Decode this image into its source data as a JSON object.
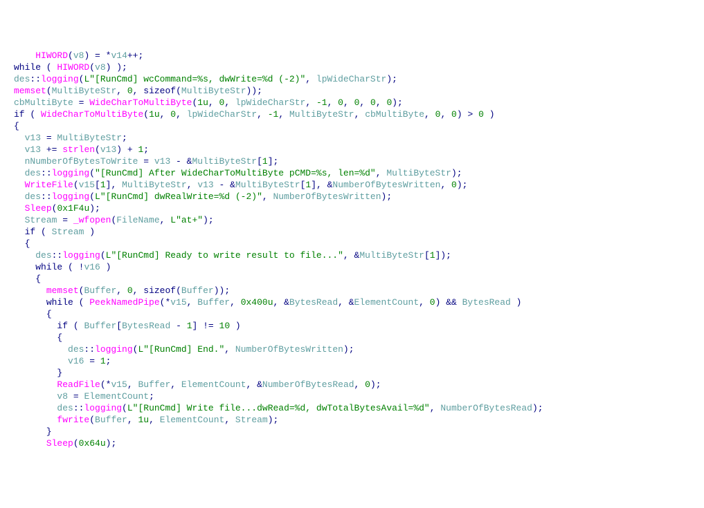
{
  "lines": [
    {
      "indent": 2,
      "tokens": [
        {
          "t": "  ",
          "c": "kw"
        },
        {
          "t": "HIWORD",
          "c": "fn"
        },
        {
          "t": "(",
          "c": "punc"
        },
        {
          "t": "v8",
          "c": "var"
        },
        {
          "t": ") = *",
          "c": "punc"
        },
        {
          "t": "v14",
          "c": "var"
        },
        {
          "t": "++;",
          "c": "punc"
        }
      ]
    },
    {
      "indent": 0,
      "tokens": [
        {
          "t": "while ( ",
          "c": "kw"
        },
        {
          "t": "HIWORD",
          "c": "fn"
        },
        {
          "t": "(",
          "c": "punc"
        },
        {
          "t": "v8",
          "c": "var"
        },
        {
          "t": ") );",
          "c": "punc"
        }
      ]
    },
    {
      "indent": 0,
      "tokens": [
        {
          "t": "des",
          "c": "var"
        },
        {
          "t": "::",
          "c": "punc"
        },
        {
          "t": "logging",
          "c": "fn"
        },
        {
          "t": "(",
          "c": "punc"
        },
        {
          "t": "L\"[RunCmd] wcCommand=%s, dwWrite=%d (-2)\"",
          "c": "str"
        },
        {
          "t": ", ",
          "c": "punc"
        },
        {
          "t": "lpWideCharStr",
          "c": "var"
        },
        {
          "t": ");",
          "c": "punc"
        }
      ]
    },
    {
      "indent": 0,
      "tokens": [
        {
          "t": "memset",
          "c": "fn"
        },
        {
          "t": "(",
          "c": "punc"
        },
        {
          "t": "MultiByteStr",
          "c": "var"
        },
        {
          "t": ", ",
          "c": "punc"
        },
        {
          "t": "0",
          "c": "num"
        },
        {
          "t": ", ",
          "c": "punc"
        },
        {
          "t": "sizeof",
          "c": "kw"
        },
        {
          "t": "(",
          "c": "punc"
        },
        {
          "t": "MultiByteStr",
          "c": "var"
        },
        {
          "t": "));",
          "c": "punc"
        }
      ]
    },
    {
      "indent": 0,
      "tokens": [
        {
          "t": "cbMultiByte",
          "c": "var"
        },
        {
          "t": " = ",
          "c": "punc"
        },
        {
          "t": "WideCharToMultiByte",
          "c": "fn"
        },
        {
          "t": "(",
          "c": "punc"
        },
        {
          "t": "1u",
          "c": "num"
        },
        {
          "t": ", ",
          "c": "punc"
        },
        {
          "t": "0",
          "c": "num"
        },
        {
          "t": ", ",
          "c": "punc"
        },
        {
          "t": "lpWideCharStr",
          "c": "var"
        },
        {
          "t": ", ",
          "c": "punc"
        },
        {
          "t": "-1",
          "c": "num"
        },
        {
          "t": ", ",
          "c": "punc"
        },
        {
          "t": "0",
          "c": "num"
        },
        {
          "t": ", ",
          "c": "punc"
        },
        {
          "t": "0",
          "c": "num"
        },
        {
          "t": ", ",
          "c": "punc"
        },
        {
          "t": "0",
          "c": "num"
        },
        {
          "t": ", ",
          "c": "punc"
        },
        {
          "t": "0",
          "c": "num"
        },
        {
          "t": ");",
          "c": "punc"
        }
      ]
    },
    {
      "indent": 0,
      "tokens": [
        {
          "t": "if ( ",
          "c": "kw"
        },
        {
          "t": "WideCharToMultiByte",
          "c": "fn"
        },
        {
          "t": "(",
          "c": "punc"
        },
        {
          "t": "1u",
          "c": "num"
        },
        {
          "t": ", ",
          "c": "punc"
        },
        {
          "t": "0",
          "c": "num"
        },
        {
          "t": ", ",
          "c": "punc"
        },
        {
          "t": "lpWideCharStr",
          "c": "var"
        },
        {
          "t": ", ",
          "c": "punc"
        },
        {
          "t": "-1",
          "c": "num"
        },
        {
          "t": ", ",
          "c": "punc"
        },
        {
          "t": "MultiByteStr",
          "c": "var"
        },
        {
          "t": ", ",
          "c": "punc"
        },
        {
          "t": "cbMultiByte",
          "c": "var"
        },
        {
          "t": ", ",
          "c": "punc"
        },
        {
          "t": "0",
          "c": "num"
        },
        {
          "t": ", ",
          "c": "punc"
        },
        {
          "t": "0",
          "c": "num"
        },
        {
          "t": ") > ",
          "c": "punc"
        },
        {
          "t": "0",
          "c": "num"
        },
        {
          "t": " )",
          "c": "punc"
        }
      ]
    },
    {
      "indent": 0,
      "tokens": [
        {
          "t": "{",
          "c": "punc"
        }
      ]
    },
    {
      "indent": 2,
      "tokens": [
        {
          "t": "v13",
          "c": "var"
        },
        {
          "t": " = ",
          "c": "punc"
        },
        {
          "t": "MultiByteStr",
          "c": "var"
        },
        {
          "t": ";",
          "c": "punc"
        }
      ]
    },
    {
      "indent": 2,
      "tokens": [
        {
          "t": "v13",
          "c": "var"
        },
        {
          "t": " += ",
          "c": "punc"
        },
        {
          "t": "strlen",
          "c": "fn"
        },
        {
          "t": "(",
          "c": "punc"
        },
        {
          "t": "v13",
          "c": "var"
        },
        {
          "t": ") + ",
          "c": "punc"
        },
        {
          "t": "1",
          "c": "num"
        },
        {
          "t": ";",
          "c": "punc"
        }
      ]
    },
    {
      "indent": 2,
      "tokens": [
        {
          "t": "nNumberOfBytesToWrite",
          "c": "var"
        },
        {
          "t": " = ",
          "c": "punc"
        },
        {
          "t": "v13",
          "c": "var"
        },
        {
          "t": " - &",
          "c": "punc"
        },
        {
          "t": "MultiByteStr",
          "c": "var"
        },
        {
          "t": "[",
          "c": "punc"
        },
        {
          "t": "1",
          "c": "num"
        },
        {
          "t": "];",
          "c": "punc"
        }
      ]
    },
    {
      "indent": 2,
      "tokens": [
        {
          "t": "des",
          "c": "var"
        },
        {
          "t": "::",
          "c": "punc"
        },
        {
          "t": "logging",
          "c": "fn"
        },
        {
          "t": "(",
          "c": "punc"
        },
        {
          "t": "\"[RunCmd] After WideCharToMultiByte pCMD=%s, len=%d\"",
          "c": "str"
        },
        {
          "t": ", ",
          "c": "punc"
        },
        {
          "t": "MultiByteStr",
          "c": "var"
        },
        {
          "t": ");",
          "c": "punc"
        }
      ]
    },
    {
      "indent": 2,
      "tokens": [
        {
          "t": "WriteFile",
          "c": "fn"
        },
        {
          "t": "(",
          "c": "punc"
        },
        {
          "t": "v15",
          "c": "var"
        },
        {
          "t": "[",
          "c": "punc"
        },
        {
          "t": "1",
          "c": "num"
        },
        {
          "t": "], ",
          "c": "punc"
        },
        {
          "t": "MultiByteStr",
          "c": "var"
        },
        {
          "t": ", ",
          "c": "punc"
        },
        {
          "t": "v13",
          "c": "var"
        },
        {
          "t": " - &",
          "c": "punc"
        },
        {
          "t": "MultiByteStr",
          "c": "var"
        },
        {
          "t": "[",
          "c": "punc"
        },
        {
          "t": "1",
          "c": "num"
        },
        {
          "t": "], &",
          "c": "punc"
        },
        {
          "t": "NumberOfBytesWritten",
          "c": "var"
        },
        {
          "t": ", ",
          "c": "punc"
        },
        {
          "t": "0",
          "c": "num"
        },
        {
          "t": ");",
          "c": "punc"
        }
      ]
    },
    {
      "indent": 2,
      "tokens": [
        {
          "t": "des",
          "c": "var"
        },
        {
          "t": "::",
          "c": "punc"
        },
        {
          "t": "logging",
          "c": "fn"
        },
        {
          "t": "(",
          "c": "punc"
        },
        {
          "t": "L\"[RunCmd] dwRealWrite=%d (-2)\"",
          "c": "str"
        },
        {
          "t": ", ",
          "c": "punc"
        },
        {
          "t": "NumberOfBytesWritten",
          "c": "var"
        },
        {
          "t": ");",
          "c": "punc"
        }
      ]
    },
    {
      "indent": 2,
      "tokens": [
        {
          "t": "Sleep",
          "c": "fn"
        },
        {
          "t": "(",
          "c": "punc"
        },
        {
          "t": "0x1F4u",
          "c": "num"
        },
        {
          "t": ");",
          "c": "punc"
        }
      ]
    },
    {
      "indent": 2,
      "tokens": [
        {
          "t": "Stream",
          "c": "var"
        },
        {
          "t": " = ",
          "c": "punc"
        },
        {
          "t": "_wfopen",
          "c": "fn"
        },
        {
          "t": "(",
          "c": "punc"
        },
        {
          "t": "FileName",
          "c": "var"
        },
        {
          "t": ", ",
          "c": "punc"
        },
        {
          "t": "L\"at+\"",
          "c": "str"
        },
        {
          "t": ");",
          "c": "punc"
        }
      ]
    },
    {
      "indent": 2,
      "tokens": [
        {
          "t": "if ( ",
          "c": "kw"
        },
        {
          "t": "Stream",
          "c": "var"
        },
        {
          "t": " )",
          "c": "punc"
        }
      ]
    },
    {
      "indent": 2,
      "tokens": [
        {
          "t": "{",
          "c": "punc"
        }
      ]
    },
    {
      "indent": 4,
      "tokens": [
        {
          "t": "des",
          "c": "var"
        },
        {
          "t": "::",
          "c": "punc"
        },
        {
          "t": "logging",
          "c": "fn"
        },
        {
          "t": "(",
          "c": "punc"
        },
        {
          "t": "L\"[RunCmd] Ready to write result to file...\"",
          "c": "str"
        },
        {
          "t": ", &",
          "c": "punc"
        },
        {
          "t": "MultiByteStr",
          "c": "var"
        },
        {
          "t": "[",
          "c": "punc"
        },
        {
          "t": "1",
          "c": "num"
        },
        {
          "t": "]);",
          "c": "punc"
        }
      ]
    },
    {
      "indent": 4,
      "tokens": [
        {
          "t": "while ( !",
          "c": "kw"
        },
        {
          "t": "v16",
          "c": "var"
        },
        {
          "t": " )",
          "c": "punc"
        }
      ]
    },
    {
      "indent": 4,
      "tokens": [
        {
          "t": "{",
          "c": "punc"
        }
      ]
    },
    {
      "indent": 6,
      "tokens": [
        {
          "t": "memset",
          "c": "fn"
        },
        {
          "t": "(",
          "c": "punc"
        },
        {
          "t": "Buffer",
          "c": "var"
        },
        {
          "t": ", ",
          "c": "punc"
        },
        {
          "t": "0",
          "c": "num"
        },
        {
          "t": ", ",
          "c": "punc"
        },
        {
          "t": "sizeof",
          "c": "kw"
        },
        {
          "t": "(",
          "c": "punc"
        },
        {
          "t": "Buffer",
          "c": "var"
        },
        {
          "t": "));",
          "c": "punc"
        }
      ]
    },
    {
      "indent": 6,
      "tokens": [
        {
          "t": "while ( ",
          "c": "kw"
        },
        {
          "t": "PeekNamedPipe",
          "c": "fn"
        },
        {
          "t": "(*",
          "c": "punc"
        },
        {
          "t": "v15",
          "c": "var"
        },
        {
          "t": ", ",
          "c": "punc"
        },
        {
          "t": "Buffer",
          "c": "var"
        },
        {
          "t": ", ",
          "c": "punc"
        },
        {
          "t": "0x400u",
          "c": "num"
        },
        {
          "t": ", &",
          "c": "punc"
        },
        {
          "t": "BytesRead",
          "c": "var"
        },
        {
          "t": ", &",
          "c": "punc"
        },
        {
          "t": "ElementCount",
          "c": "var"
        },
        {
          "t": ", ",
          "c": "punc"
        },
        {
          "t": "0",
          "c": "num"
        },
        {
          "t": ") && ",
          "c": "punc"
        },
        {
          "t": "BytesRead",
          "c": "var"
        },
        {
          "t": " )",
          "c": "punc"
        }
      ]
    },
    {
      "indent": 6,
      "tokens": [
        {
          "t": "{",
          "c": "punc"
        }
      ]
    },
    {
      "indent": 8,
      "tokens": [
        {
          "t": "if ( ",
          "c": "kw"
        },
        {
          "t": "Buffer",
          "c": "var"
        },
        {
          "t": "[",
          "c": "punc"
        },
        {
          "t": "BytesRead",
          "c": "var"
        },
        {
          "t": " - ",
          "c": "punc"
        },
        {
          "t": "1",
          "c": "num"
        },
        {
          "t": "] != ",
          "c": "punc"
        },
        {
          "t": "10",
          "c": "num"
        },
        {
          "t": " )",
          "c": "punc"
        }
      ]
    },
    {
      "indent": 8,
      "tokens": [
        {
          "t": "{",
          "c": "punc"
        }
      ]
    },
    {
      "indent": 10,
      "tokens": [
        {
          "t": "des",
          "c": "var"
        },
        {
          "t": "::",
          "c": "punc"
        },
        {
          "t": "logging",
          "c": "fn"
        },
        {
          "t": "(",
          "c": "punc"
        },
        {
          "t": "L\"[RunCmd] End.\"",
          "c": "str"
        },
        {
          "t": ", ",
          "c": "punc"
        },
        {
          "t": "NumberOfBytesWritten",
          "c": "var"
        },
        {
          "t": ");",
          "c": "punc"
        }
      ]
    },
    {
      "indent": 10,
      "tokens": [
        {
          "t": "v16",
          "c": "var"
        },
        {
          "t": " = ",
          "c": "punc"
        },
        {
          "t": "1",
          "c": "num"
        },
        {
          "t": ";",
          "c": "punc"
        }
      ]
    },
    {
      "indent": 8,
      "tokens": [
        {
          "t": "}",
          "c": "punc"
        }
      ]
    },
    {
      "indent": 8,
      "tokens": [
        {
          "t": "ReadFile",
          "c": "fn"
        },
        {
          "t": "(*",
          "c": "punc"
        },
        {
          "t": "v15",
          "c": "var"
        },
        {
          "t": ", ",
          "c": "punc"
        },
        {
          "t": "Buffer",
          "c": "var"
        },
        {
          "t": ", ",
          "c": "punc"
        },
        {
          "t": "ElementCount",
          "c": "var"
        },
        {
          "t": ", &",
          "c": "punc"
        },
        {
          "t": "NumberOfBytesRead",
          "c": "var"
        },
        {
          "t": ", ",
          "c": "punc"
        },
        {
          "t": "0",
          "c": "num"
        },
        {
          "t": ");",
          "c": "punc"
        }
      ]
    },
    {
      "indent": 8,
      "tokens": [
        {
          "t": "v8",
          "c": "var"
        },
        {
          "t": " = ",
          "c": "punc"
        },
        {
          "t": "ElementCount",
          "c": "var"
        },
        {
          "t": ";",
          "c": "punc"
        }
      ]
    },
    {
      "indent": 8,
      "tokens": [
        {
          "t": "des",
          "c": "var"
        },
        {
          "t": "::",
          "c": "punc"
        },
        {
          "t": "logging",
          "c": "fn"
        },
        {
          "t": "(",
          "c": "punc"
        },
        {
          "t": "L\"[RunCmd] Write file...dwRead=%d, dwTotalBytesAvail=%d\"",
          "c": "str"
        },
        {
          "t": ", ",
          "c": "punc"
        },
        {
          "t": "NumberOfBytesRead",
          "c": "var"
        },
        {
          "t": ");",
          "c": "punc"
        }
      ]
    },
    {
      "indent": 8,
      "tokens": [
        {
          "t": "fwrite",
          "c": "fn"
        },
        {
          "t": "(",
          "c": "punc"
        },
        {
          "t": "Buffer",
          "c": "var"
        },
        {
          "t": ", ",
          "c": "punc"
        },
        {
          "t": "1u",
          "c": "num"
        },
        {
          "t": ", ",
          "c": "punc"
        },
        {
          "t": "ElementCount",
          "c": "var"
        },
        {
          "t": ", ",
          "c": "punc"
        },
        {
          "t": "Stream",
          "c": "var"
        },
        {
          "t": ");",
          "c": "punc"
        }
      ]
    },
    {
      "indent": 6,
      "tokens": [
        {
          "t": "}",
          "c": "punc"
        }
      ]
    },
    {
      "indent": 6,
      "tokens": [
        {
          "t": "Sleep",
          "c": "fn"
        },
        {
          "t": "(",
          "c": "punc"
        },
        {
          "t": "0x64u",
          "c": "num"
        },
        {
          "t": ");",
          "c": "punc"
        }
      ]
    }
  ]
}
